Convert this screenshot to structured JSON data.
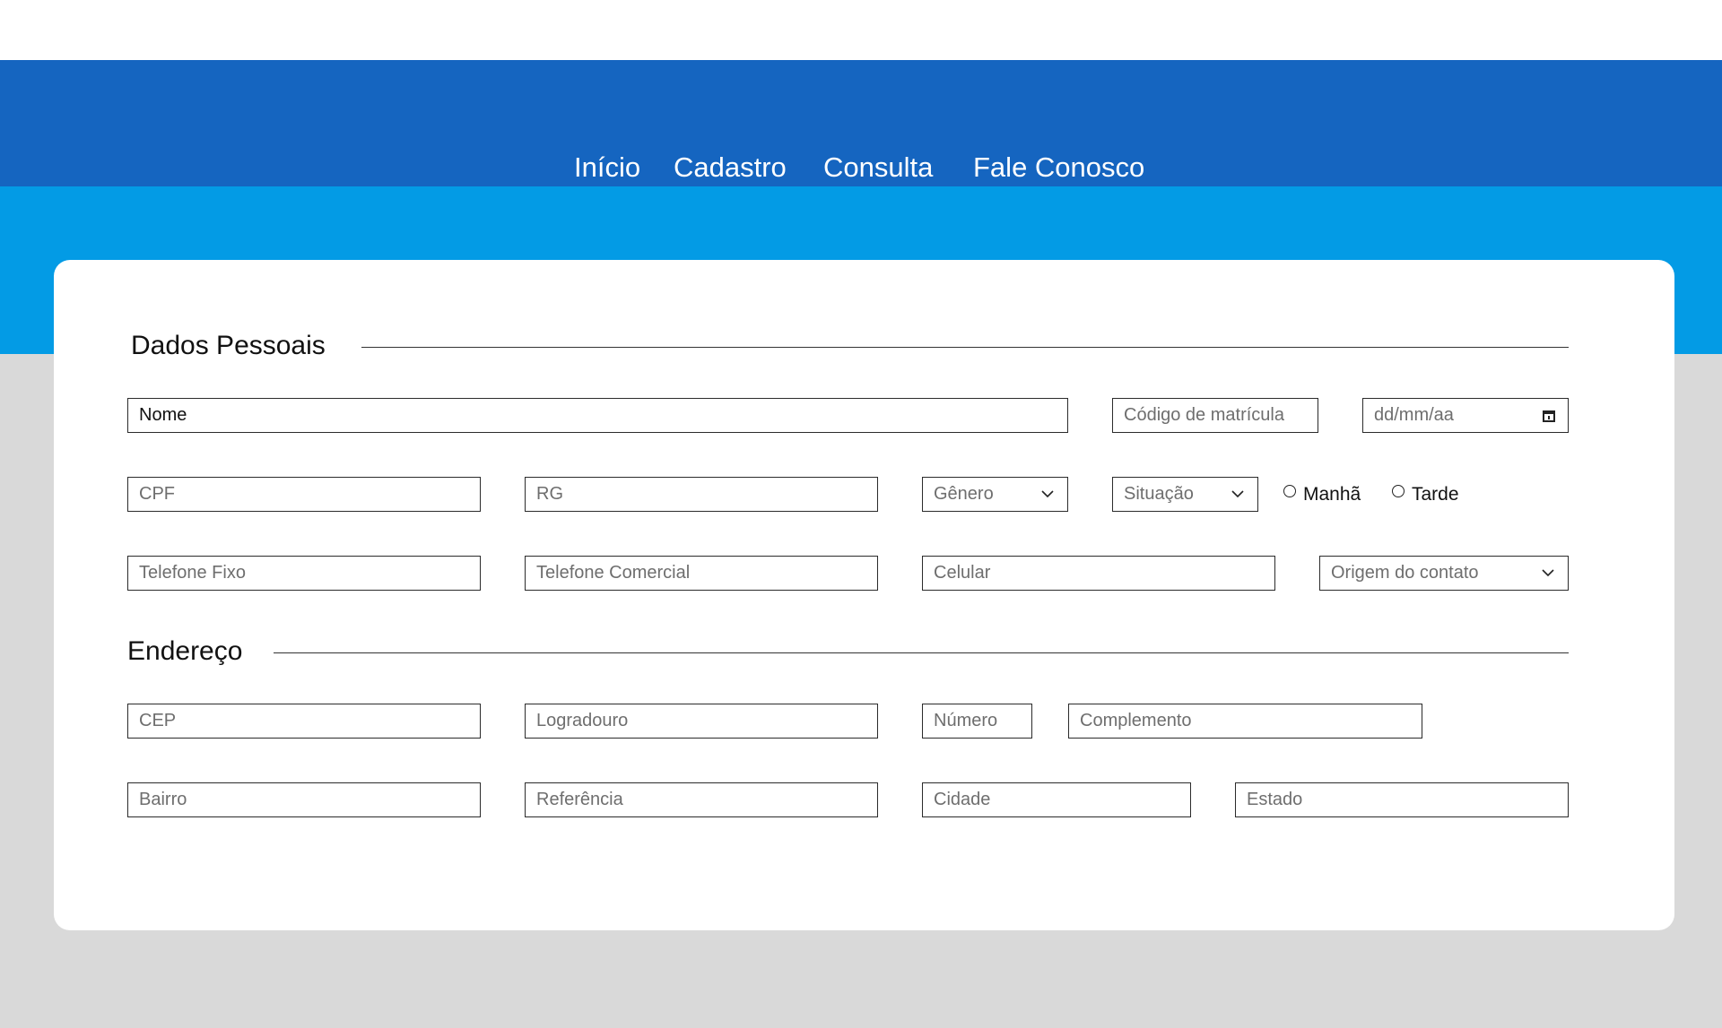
{
  "nav": {
    "items": [
      "Início",
      "Cadastro",
      "Consulta",
      "Fale Conosco"
    ]
  },
  "personal": {
    "title": "Dados Pessoais",
    "nome_value": "Nome",
    "codigo_placeholder": "Código de matrícula",
    "date_placeholder": "dd/mm/aa",
    "cpf_placeholder": "CPF",
    "rg_placeholder": "RG",
    "genero_label": "Gênero",
    "situacao_label": "Situação",
    "radio_manha": "Manhã",
    "radio_tarde": "Tarde",
    "telefone_fixo_placeholder": "Telefone Fixo",
    "telefone_comercial_placeholder": "Telefone Comercial",
    "celular_placeholder": "Celular",
    "origem_label": "Origem do contato"
  },
  "address": {
    "title": "Endereço",
    "cep_placeholder": "CEP",
    "logradouro_placeholder": "Logradouro",
    "numero_placeholder": "Número",
    "complemento_placeholder": "Complemento",
    "bairro_placeholder": "Bairro",
    "referencia_placeholder": "Referência",
    "cidade_placeholder": "Cidade",
    "estado_placeholder": "Estado"
  },
  "colors": {
    "navbar": "#1565c0",
    "band": "#039be5",
    "background": "#d9d9d9",
    "card": "#ffffff"
  }
}
